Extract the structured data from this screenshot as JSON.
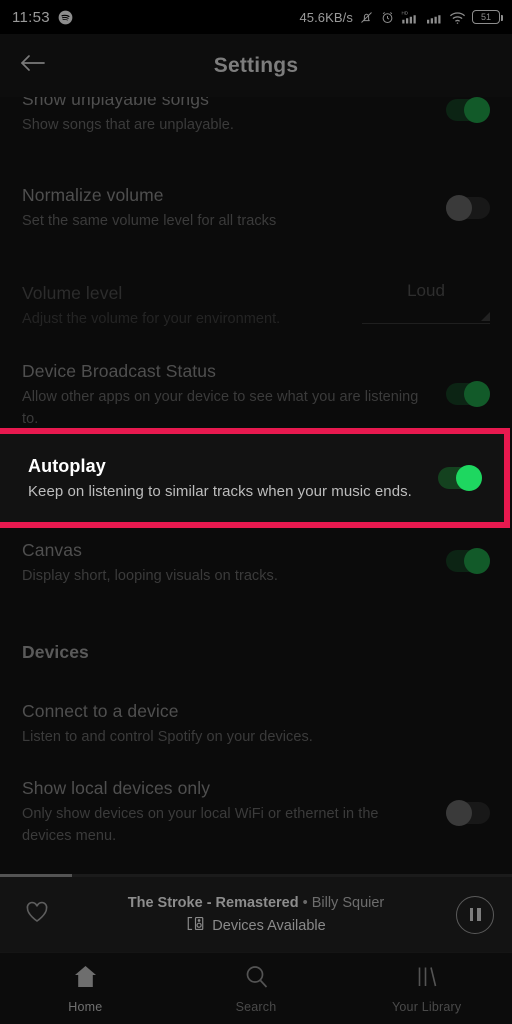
{
  "status_bar": {
    "time": "11:53",
    "spotify_icon": "spotify-logo-icon",
    "network_speed": "45.6KB/s",
    "icons": [
      "notifications-off-icon",
      "alarm-clock-icon",
      "hd-signal-icon",
      "signal-bars-icon",
      "wifi-icon"
    ],
    "battery_level": "51"
  },
  "header": {
    "title": "Settings",
    "back_icon": "back-arrow-icon"
  },
  "settings": {
    "rows": [
      {
        "title": "Show unplayable songs",
        "subtitle": "Show songs that are unplayable.",
        "control": "toggle",
        "toggle_state": "on",
        "disabled": false
      },
      {
        "title": "Normalize volume",
        "subtitle": "Set the same volume level for all tracks",
        "control": "toggle",
        "toggle_state": "off",
        "disabled": false
      },
      {
        "title": "Volume level",
        "subtitle": "Adjust the volume for your environment.",
        "control": "select",
        "select_value": "Loud",
        "disabled": true
      },
      {
        "title": "Device Broadcast Status",
        "subtitle": "Allow other apps on your device to see what you are listening to.",
        "control": "toggle",
        "toggle_state": "on",
        "disabled": false
      },
      {
        "title": "Canvas",
        "subtitle": "Display short, looping visuals on tracks.",
        "control": "toggle",
        "toggle_state": "on",
        "disabled": false
      }
    ],
    "highlighted_row": {
      "title": "Autoplay",
      "subtitle": "Keep on listening to similar tracks when your music ends.",
      "control": "toggle",
      "toggle_state": "on",
      "highlight_color": "#e8194f"
    },
    "devices_section": {
      "heading": "Devices",
      "rows": [
        {
          "title": "Connect to a device",
          "subtitle": "Listen to and control Spotify on your devices.",
          "control": "none"
        },
        {
          "title": "Show local devices only",
          "subtitle": "Only show devices on your local WiFi or ethernet in the devices menu.",
          "control": "toggle",
          "toggle_state": "off"
        }
      ]
    }
  },
  "now_playing": {
    "track": "The Stroke - Remastered",
    "separator": "•",
    "artist": "Billy Squier",
    "devices_text": "Devices Available",
    "devices_icon": "cast-devices-icon",
    "like_icon": "heart-outline-icon",
    "play_icon": "pause-circle-icon",
    "progress_percent": 14
  },
  "bottom_nav": {
    "items": [
      {
        "label": "Home",
        "icon": "home-icon",
        "active": true
      },
      {
        "label": "Search",
        "icon": "search-icon",
        "active": false
      },
      {
        "label": "Your Library",
        "icon": "library-icon",
        "active": false
      }
    ]
  },
  "theme": {
    "accent_green": "#1ed760",
    "highlight_pink": "#e8194f",
    "background": "#0b0b0b"
  }
}
